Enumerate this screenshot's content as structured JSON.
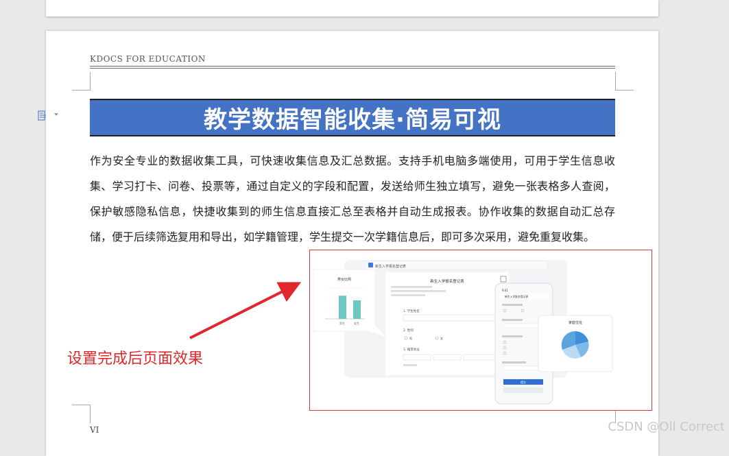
{
  "header": {
    "text": "KDOCS FOR EDUCATION"
  },
  "document": {
    "title": "教学数据智能收集·简易可视",
    "paragraph": "作为安全专业的数据收集工具，可快速收集信息及汇总数据。支持手机电脑多端使用，可用于学生信息收集、学习打卡、问卷、投票等，通过自定义的字段和配置，发送给师生独立填写，避免一张表格多人查阅，保护敏感隐私信息，快捷收集到的师生信息直接汇总至表格并自动生成报表。协作收集的数据自动汇总存储，便于后续筛选复用和导出，如学籍管理，学生提交一次学籍信息后，即可多次采用，避免重复收集。"
  },
  "annotation": {
    "text": "设置完成后页面效果",
    "color": "#e0262b"
  },
  "screenshot": {
    "window_title": "新生入学报名登记表",
    "form_title": "新生入学报名登记表",
    "field_name": "1. 学生姓名",
    "field_gender": "2. 性别",
    "gender_options": [
      "男",
      "女"
    ],
    "field_grade": "3. 籍贯地址",
    "bar_chart_title": "男女比例",
    "bar_labels": [
      "男生",
      "女生"
    ],
    "bar_values": [
      0.75,
      0.6
    ],
    "pie_chart_title": "家庭住址",
    "mobile_time": "9:41",
    "mobile_title": "新生入学报名登记表",
    "mobile_submit": "提交"
  },
  "footer": {
    "page_label": "VI"
  },
  "watermark": {
    "text": "CSDN @Oll Correct"
  },
  "colors": {
    "title_band": "#4472c4",
    "accent": "#2f6fd6"
  }
}
